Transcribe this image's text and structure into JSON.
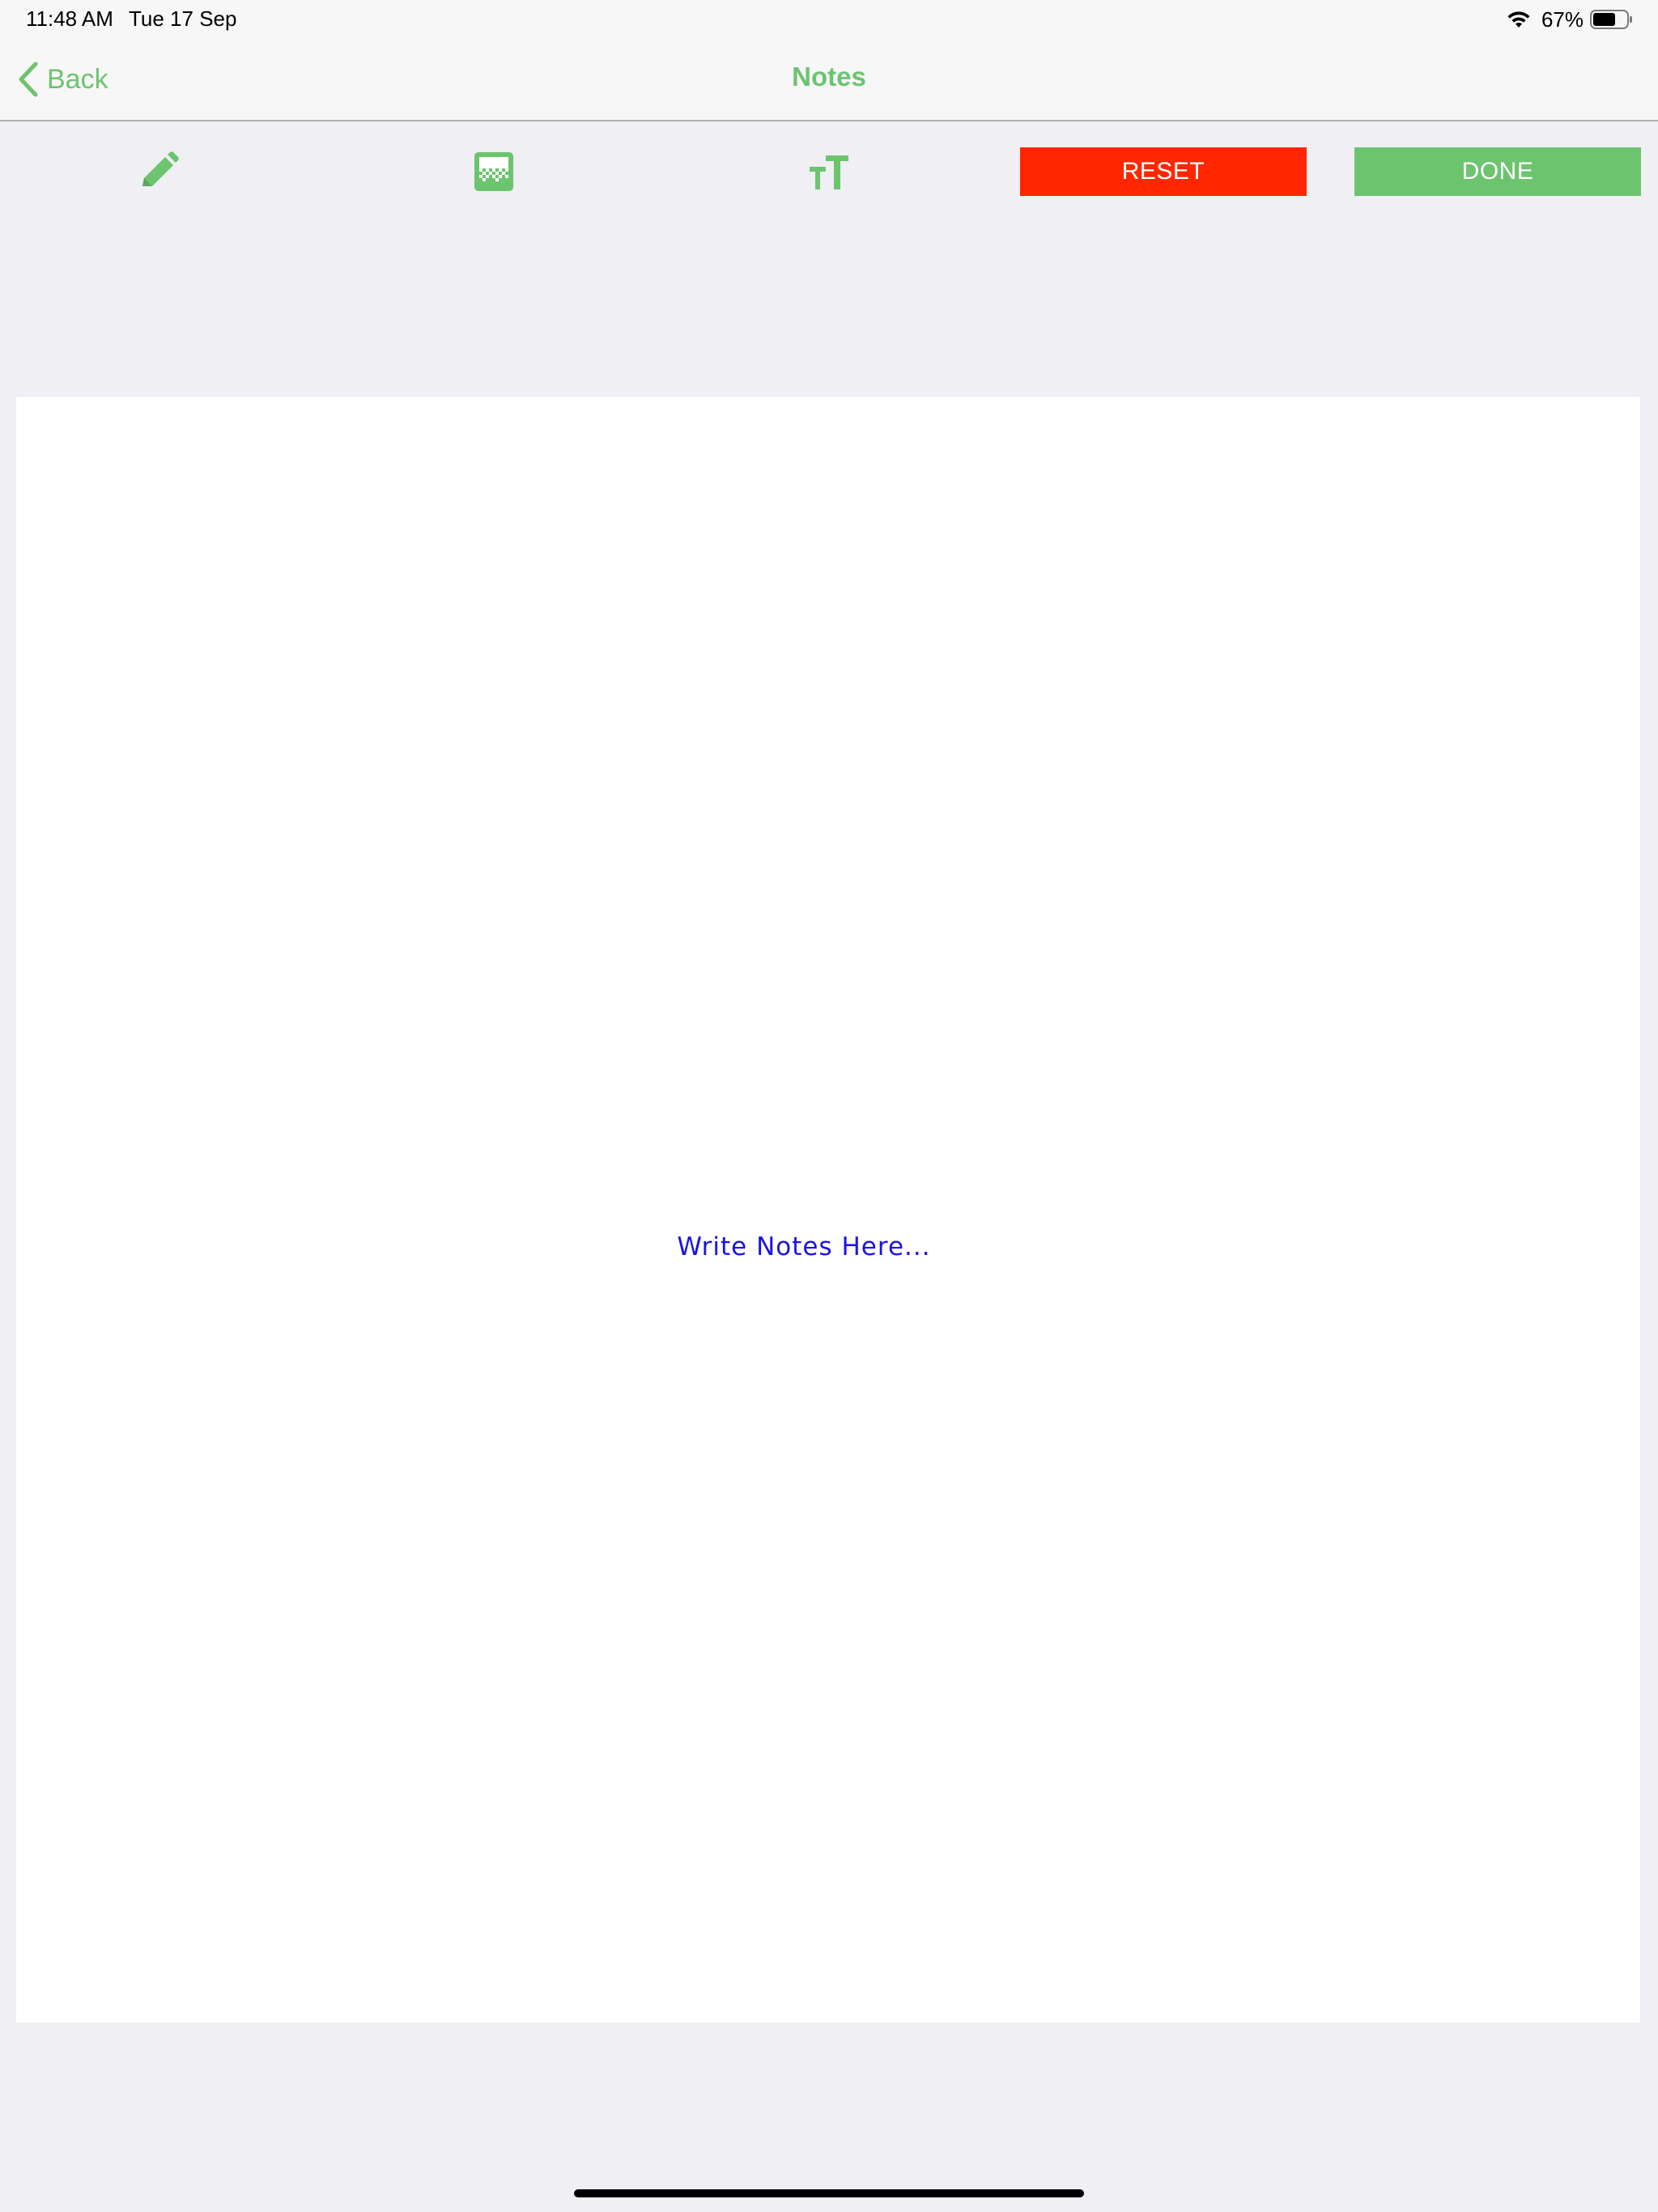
{
  "status_bar": {
    "time": "11:48 AM",
    "date": "Tue 17 Sep",
    "battery_percent": "67%",
    "battery_level": 0.67,
    "wifi_icon": "wifi-icon",
    "battery_icon": "battery-icon"
  },
  "nav": {
    "back_label": "Back",
    "title": "Notes",
    "back_icon": "chevron-left-icon"
  },
  "toolbar": {
    "tools": [
      {
        "name": "pencil",
        "icon": "pencil-icon"
      },
      {
        "name": "eraser",
        "icon": "eraser-icon"
      },
      {
        "name": "text-size",
        "icon": "text-size-icon"
      }
    ],
    "reset_label": "RESET",
    "done_label": "DONE"
  },
  "canvas": {
    "placeholder": "Write Notes Here..."
  },
  "colors": {
    "accent": "#6cc46f",
    "reset": "#ff2600",
    "placeholder_text": "#1a14e0",
    "background": "#efeff4"
  }
}
